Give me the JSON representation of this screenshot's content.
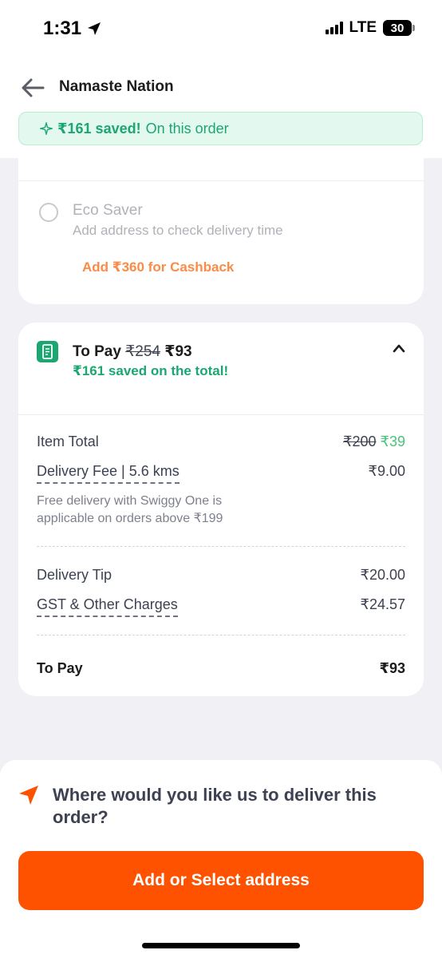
{
  "status": {
    "time": "1:31",
    "network": "LTE",
    "battery": "30"
  },
  "header": {
    "title": "Namaste Nation",
    "savings_amount": "₹161 saved!",
    "savings_suffix": "On this order"
  },
  "delivery_options": {
    "eco_title": "Eco Saver",
    "eco_subtitle": "Add address to check delivery time",
    "cashback_hint": "Add ₹360 for Cashback"
  },
  "bill": {
    "to_pay_label": "To Pay",
    "original_total": "₹254",
    "final_total": "₹93",
    "saved_text": "₹161 saved on the total!",
    "item_total_label": "Item Total",
    "item_total_original": "₹200",
    "item_total_discounted": "₹39",
    "delivery_fee_label": "Delivery Fee | 5.6 kms",
    "delivery_fee_value": "₹9.00",
    "free_delivery_note": "Free delivery with Swiggy One is applicable on orders above ₹199",
    "tip_label": "Delivery Tip",
    "tip_value": "₹20.00",
    "gst_label": "GST & Other Charges",
    "gst_value": "₹24.57",
    "grand_total_label": "To Pay",
    "grand_total_value": "₹93"
  },
  "bottom": {
    "prompt": "Where would you like us to deliver this order?",
    "cta_label": "Add or Select address"
  },
  "colors": {
    "brand_orange": "#fe5200",
    "savings_green": "#1ba672",
    "cashback_orange": "#fb8b46"
  },
  "icons": [
    "location-arrow-icon",
    "back-arrow-icon",
    "sparkle-icon",
    "receipt-icon",
    "chevron-up-icon",
    "navigation-arrow-icon"
  ]
}
